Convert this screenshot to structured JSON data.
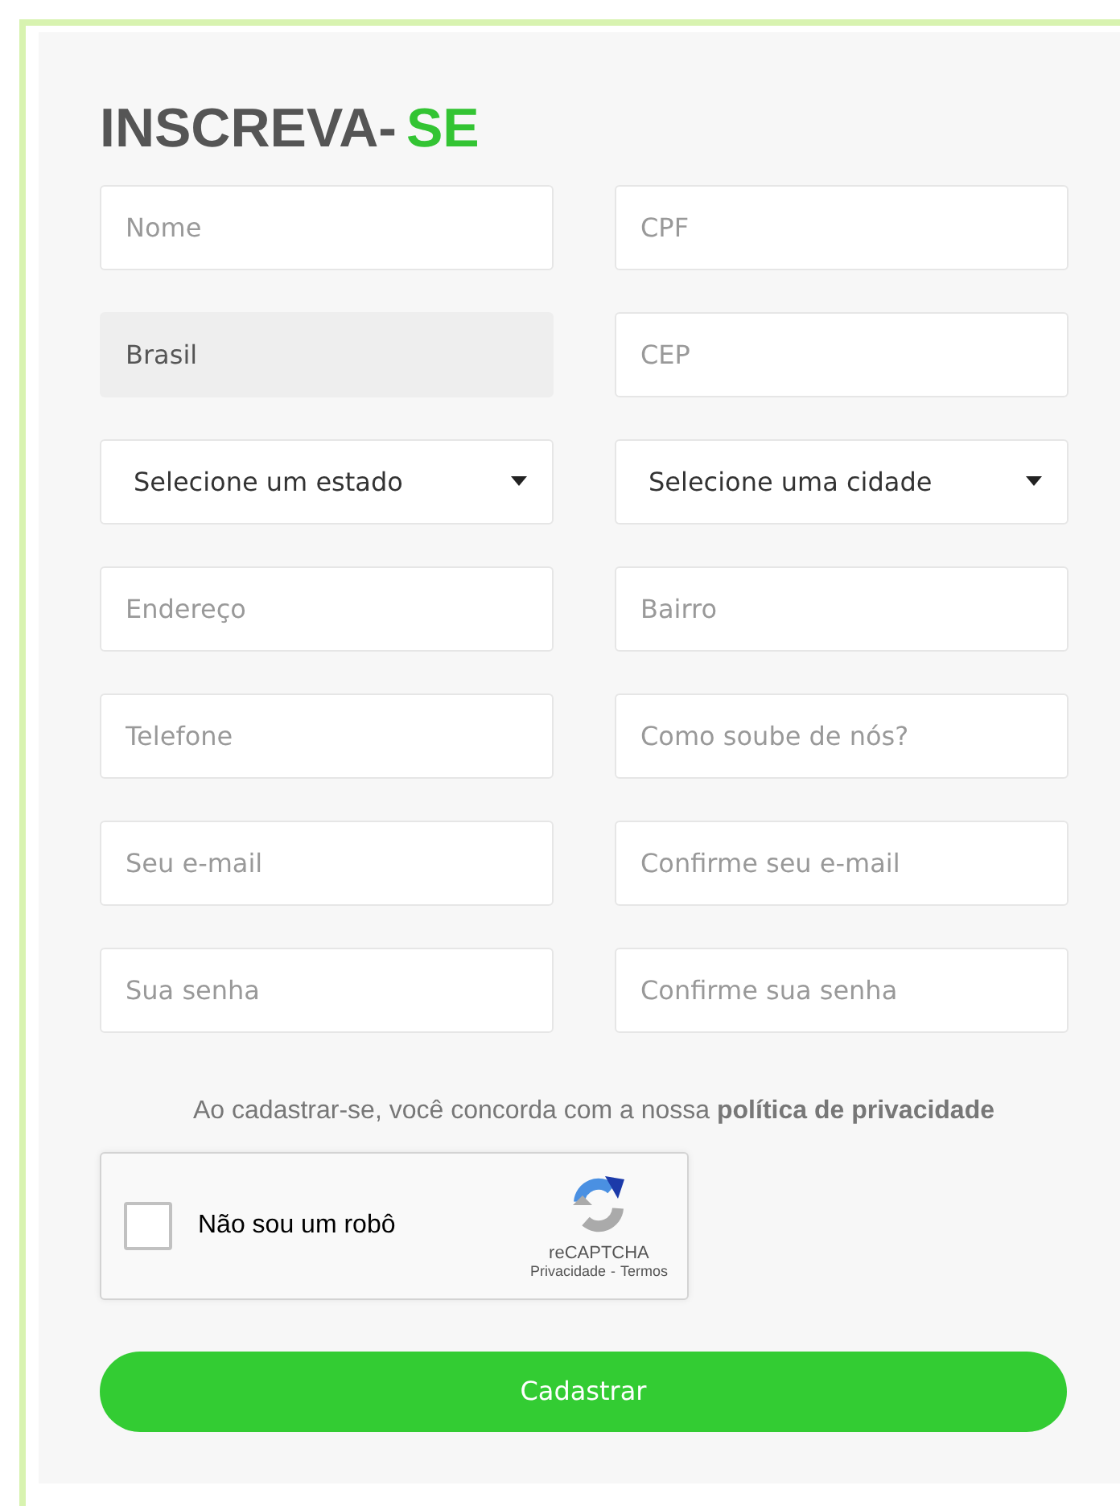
{
  "title": {
    "main": "INSCREVA-",
    "accent": "SE"
  },
  "fields": [
    {
      "kind": "input",
      "placeholder": "Nome",
      "disabled": false
    },
    {
      "kind": "input",
      "placeholder": "CPF",
      "disabled": false
    },
    {
      "kind": "input",
      "value": "Brasil",
      "disabled": true
    },
    {
      "kind": "input",
      "placeholder": "CEP",
      "disabled": false
    },
    {
      "kind": "select",
      "value": "Selecione um estado",
      "disabled": false
    },
    {
      "kind": "select",
      "value": "Selecione uma cidade",
      "disabled": false
    },
    {
      "kind": "input",
      "placeholder": "Endereço",
      "disabled": false
    },
    {
      "kind": "input",
      "placeholder": "Bairro",
      "disabled": false
    },
    {
      "kind": "input",
      "placeholder": "Telefone",
      "disabled": false
    },
    {
      "kind": "input",
      "placeholder": "Como soube de nós?",
      "disabled": false
    },
    {
      "kind": "input",
      "placeholder": "Seu e-mail",
      "disabled": false
    },
    {
      "kind": "input",
      "placeholder": "Confirme seu e-mail",
      "disabled": false
    },
    {
      "kind": "input",
      "placeholder": "Sua senha",
      "disabled": false
    },
    {
      "kind": "input",
      "placeholder": "Confirme sua senha",
      "disabled": false
    }
  ],
  "terms": "Ao cadastrar-se, você concorda com a nossa **política de privacidade**",
  "captcha": {
    "checked": false,
    "label": "Não sou um robô",
    "brand": "reCAPTCHA",
    "privacy": "Privacidade",
    "separator": "-",
    "terms": "Termos"
  },
  "submit": "Cadastrar"
}
